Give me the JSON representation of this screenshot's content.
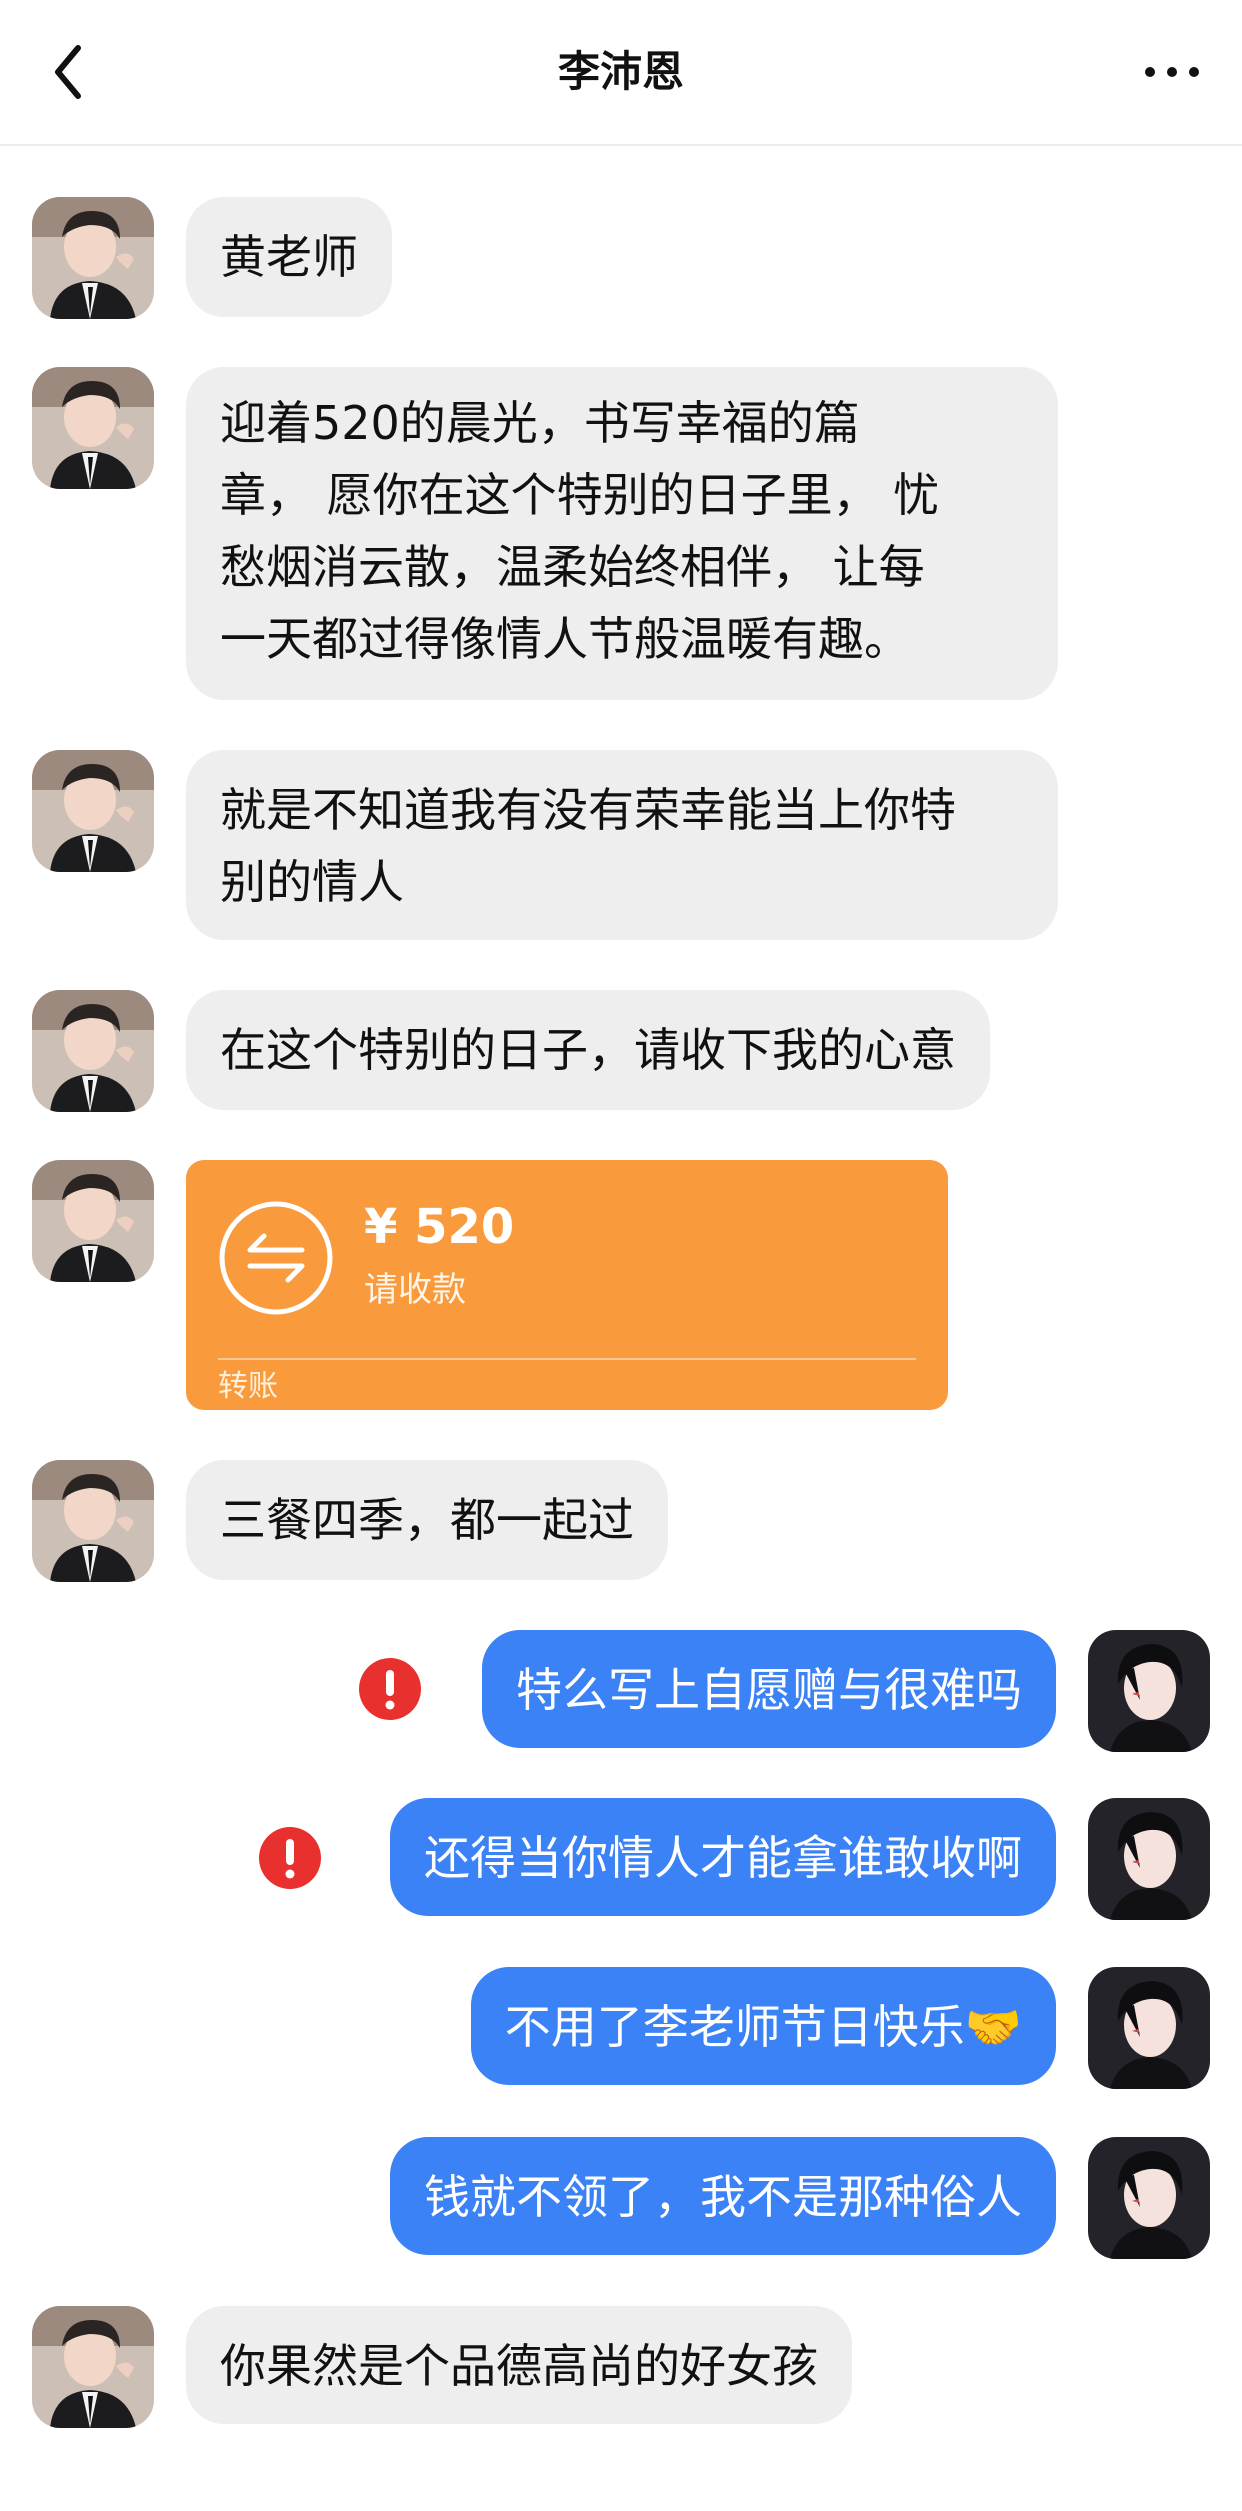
{
  "header": {
    "title": "李沛恩"
  },
  "messages": [
    {
      "text": "黄老师"
    },
    {
      "lines": [
        "迎着520的晨光，书写幸福的篇",
        "章， 愿你在这个特别的日子里， 忧",
        "愁烟消云散，温柔始终相伴， 让每",
        "一天都过得像情人节般温暖有趣。"
      ]
    },
    {
      "lines": [
        "就是不知道我有没有荣幸能当上你特",
        "别的情人"
      ]
    },
    {
      "text": "在这个特别的日子，请收下我的心意"
    },
    {
      "text": "三餐四季，都一起过"
    },
    {
      "text": "特么写上自愿赠与很难吗"
    },
    {
      "text": "还得当你情人才能拿谁敢收啊"
    },
    {
      "text": "不用了李老师节日快乐🤝"
    },
    {
      "text": "钱就不领了，我不是那种俗人"
    },
    {
      "text": "你果然是个品德高尚的好女孩"
    }
  ],
  "transfer": {
    "amount": "¥ 520",
    "status": "请收款",
    "label": "转账"
  },
  "colors": {
    "outgoing_bubble": "#3b82f6",
    "incoming_bubble": "#eeeeee",
    "transfer_card": "#f99a3c",
    "alert": "#e8302e"
  },
  "icons": {
    "back": "chevron-left-icon",
    "more": "more-dots-icon",
    "transfer": "transfer-arrows-icon",
    "failed": "exclamation-alert-icon"
  }
}
